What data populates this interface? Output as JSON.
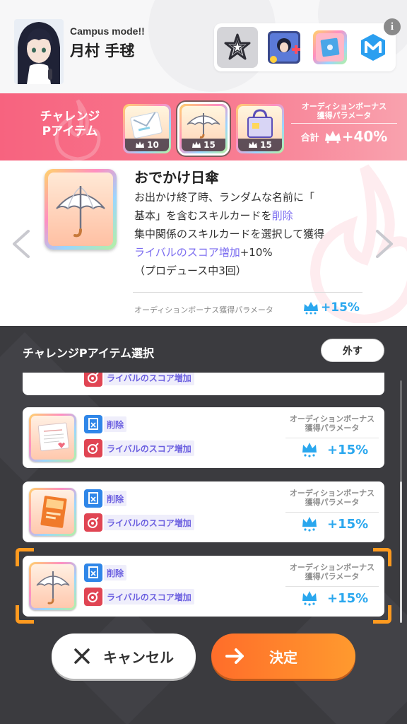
{
  "header": {
    "mode_label": "Campus mode!!",
    "player_name": "月村 手毬",
    "tray_icons": [
      "sparkle-emblem-icon",
      "idol-card-plus-icon",
      "disc-item-icon",
      "m-logo-icon"
    ],
    "info_glyph": "i"
  },
  "challenge": {
    "title_line1": "チャレンジ",
    "title_line2": "Pアイテム",
    "slots": [
      {
        "icon": "letter-item-icon",
        "value": "10"
      },
      {
        "icon": "umbrella-item-icon",
        "value": "15"
      },
      {
        "icon": "bag-item-icon",
        "value": "15"
      }
    ],
    "bonus_head_line1": "オーディションボーナス",
    "bonus_head_line2": "獲得パラメータ",
    "total_label": "合計",
    "total_value": "+40%"
  },
  "detail": {
    "item_name": "おでかけ日傘",
    "desc_line1": "お出かけ終了時、ランダムな名前に「",
    "desc_line2_a": "基本」を含むスキルカードを",
    "desc_line2_hl": "削除",
    "desc_line3": "集中関係のスキルカードを選択して獲得",
    "desc_line4_hl": "ライバルのスコア増加",
    "desc_line4_b": "+10%",
    "desc_line5": "（プロデュース中3回）",
    "bonus_label": "オーディションボーナス獲得パラメータ",
    "bonus_value": "+15%"
  },
  "selection": {
    "title": "チャレンジPアイテム選択",
    "remove_label": "外す",
    "partial_tag": "ライバルのスコア増加",
    "cards": [
      {
        "icon": "letter-item-icon",
        "tag1": "削除",
        "tag2": "ライバルのスコア増加",
        "bonus_head1": "オーディションボーナス",
        "bonus_head2": "獲得パラメータ",
        "bonus_value": "+15%"
      },
      {
        "icon": "book-item-icon",
        "tag1": "削除",
        "tag2": "ライバルのスコア増加",
        "bonus_head1": "オーディションボーナス",
        "bonus_head2": "獲得パラメータ",
        "bonus_value": "+15%"
      },
      {
        "icon": "umbrella-item-icon",
        "tag1": "削除",
        "tag2": "ライバルのスコア増加",
        "bonus_head1": "オーディションボーナス",
        "bonus_head2": "獲得パラメータ",
        "bonus_value": "+15%"
      }
    ]
  },
  "buttons": {
    "cancel_label": "キャンセル",
    "ok_label": "決定"
  },
  "colors": {
    "accent_pink": "#f7637f",
    "bonus_blue": "#2aa7ee",
    "highlight_purple": "#7b6cf0",
    "ok_orange": "#ff7a2a",
    "select_corner": "#ff9a1f"
  }
}
